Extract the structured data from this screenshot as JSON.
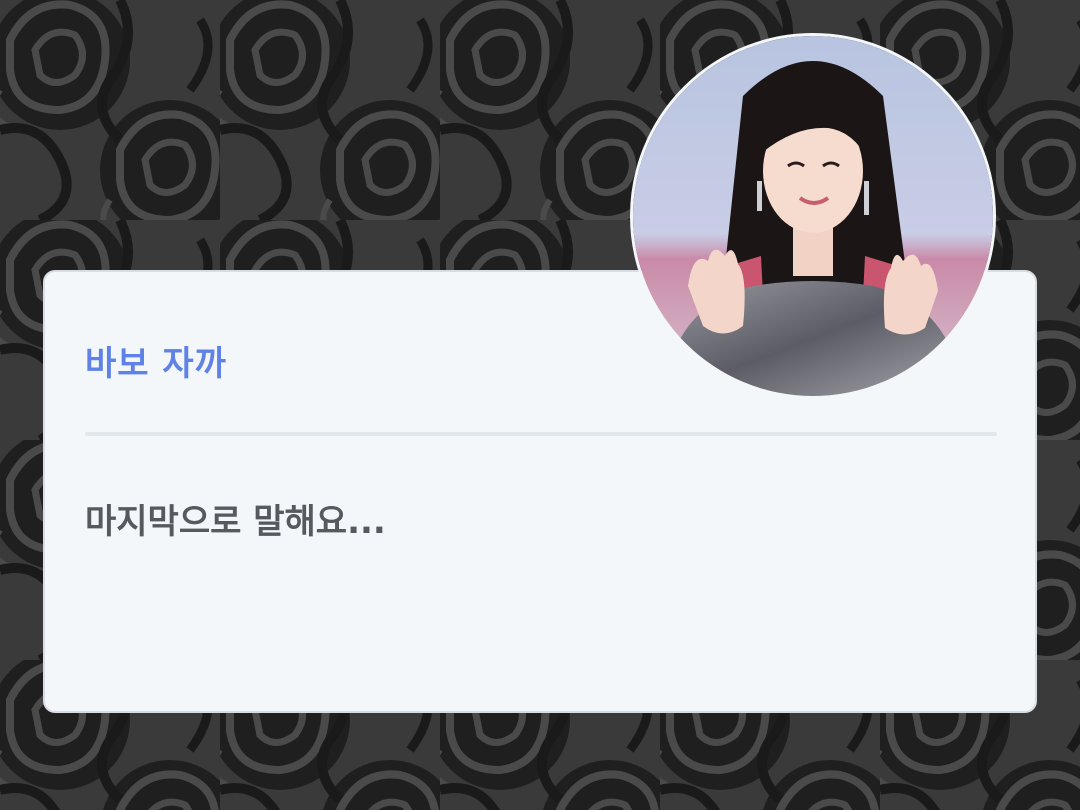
{
  "card": {
    "title": "바보 자까",
    "message": "마지막으로 말해요..."
  },
  "avatar": {
    "description_icon": "profile-photo"
  },
  "colors": {
    "background": "#3a3a3a",
    "rose_pattern": "#1e1e1e",
    "card_background": "#f4f7f9",
    "title": "#5f82e6",
    "message": "#555a5f",
    "divider": "#e2e7ec"
  }
}
